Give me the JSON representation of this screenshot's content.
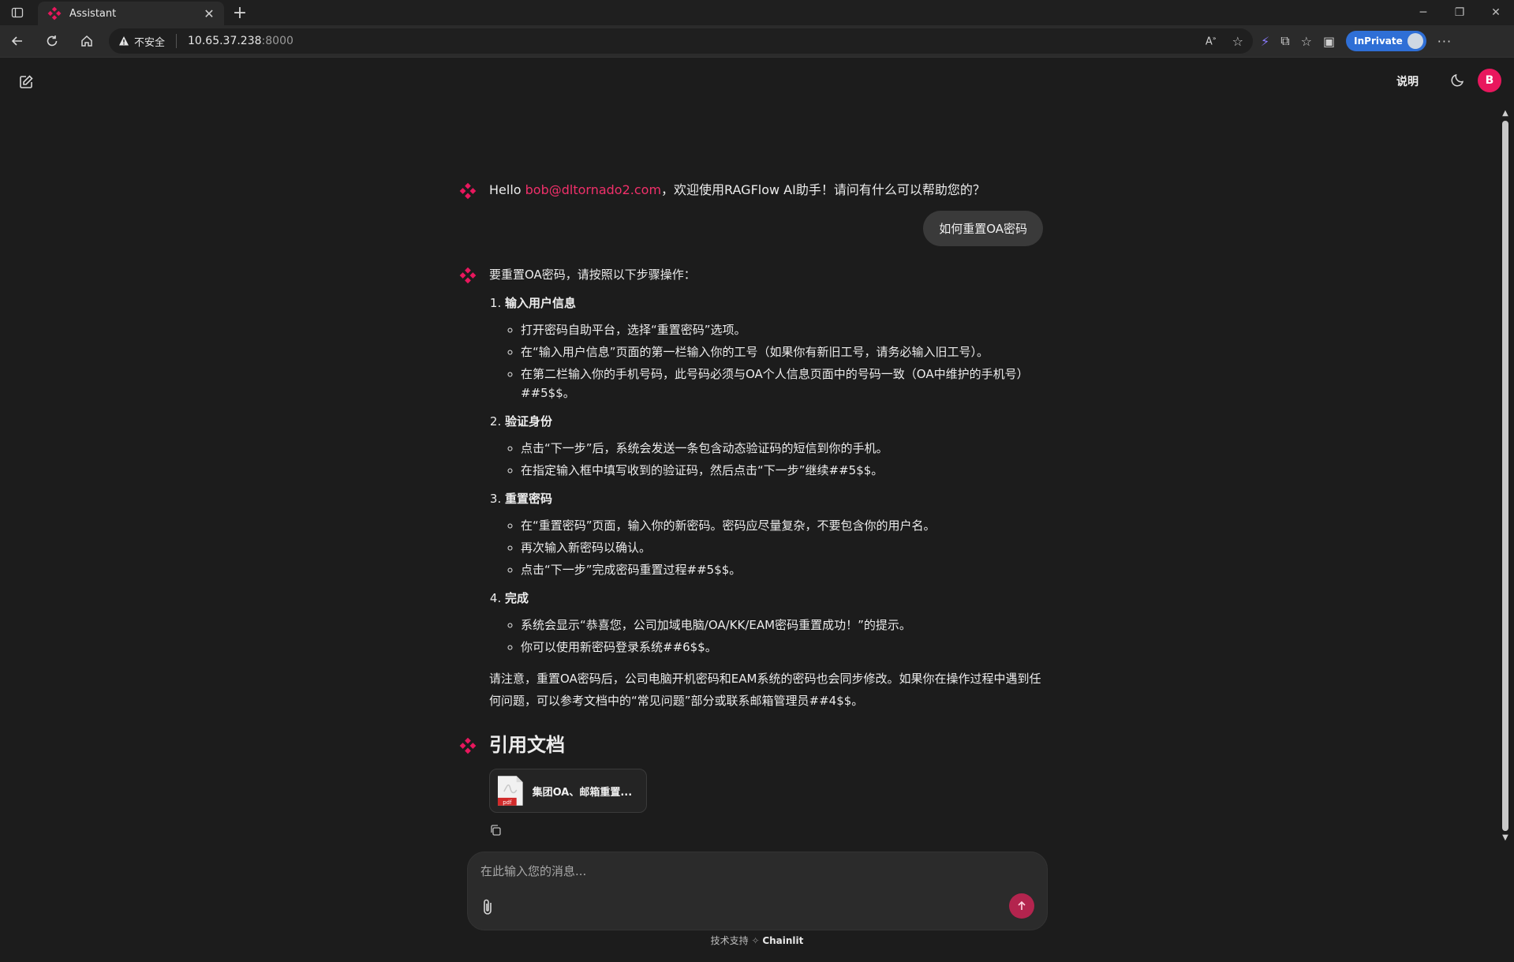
{
  "browser": {
    "tab_title": "Assistant",
    "security_label": "不安全",
    "url_host": "10.65.37.238",
    "url_port": ":8000",
    "inprivate_label": "InPrivate"
  },
  "header": {
    "readme_label": "说明",
    "user_initial": "B"
  },
  "greeting": {
    "prefix": "Hello ",
    "email": "bob@dltornado2.com",
    "suffix": "，欢迎使用RAGFlow AI助手！请问有什么可以帮助您的？"
  },
  "user_message": "如何重置OA密码",
  "answer": {
    "intro": "要重置OA密码，请按照以下步骤操作：",
    "steps": [
      {
        "title": "输入用户信息",
        "items": [
          "打开密码自助平台，选择“重置密码”选项。",
          "在“输入用户信息”页面的第一栏输入你的工号（如果你有新旧工号，请务必输入旧工号）。",
          "在第二栏输入你的手机号码，此号码必须与OA个人信息页面中的号码一致（OA中维护的手机号）##5$$。"
        ]
      },
      {
        "title": "验证身份",
        "items": [
          "点击“下一步”后，系统会发送一条包含动态验证码的短信到你的手机。",
          "在指定输入框中填写收到的验证码，然后点击“下一步”继续##5$$。"
        ]
      },
      {
        "title": "重置密码",
        "items": [
          "在“重置密码”页面，输入你的新密码。密码应尽量复杂，不要包含你的用户名。",
          "再次输入新密码以确认。",
          "点击“下一步”完成密码重置过程##5$$。"
        ]
      },
      {
        "title": "完成",
        "items": [
          "系统会显示“恭喜您，公司加域电脑/OA/KK/EAM密码重置成功！”的提示。",
          "你可以使用新密码登录系统##6$$。"
        ]
      }
    ],
    "note": "请注意，重置OA密码后，公司电脑开机密码和EAM系统的密码也会同步修改。如果你在操作过程中遇到任何问题，可以参考文档中的“常见问题”部分或联系邮箱管理员##4$$。"
  },
  "references": {
    "title": "引用文档",
    "files": [
      {
        "name": "集团OA、邮箱重置...",
        "icon": "pdf-file-icon",
        "badge": "pdf"
      }
    ]
  },
  "composer": {
    "placeholder": "在此输入您的消息..."
  },
  "footer": {
    "prefix": "技术支持",
    "brand": "Chainlit"
  },
  "colors": {
    "accent": "#e8175d",
    "email_link": "#f0306a",
    "send_button": "#b3244e",
    "background": "#1c1c1c"
  }
}
